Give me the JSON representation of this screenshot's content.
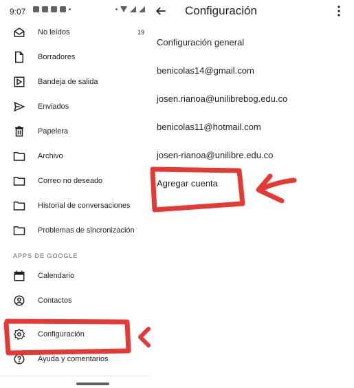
{
  "status_bar": {
    "time": "9:07"
  },
  "drawer": {
    "items": [
      {
        "label": "No leídos",
        "count": "19",
        "icon": "inbox-icon"
      },
      {
        "label": "Borradores",
        "icon": "draft-icon"
      },
      {
        "label": "Bandeja de salida",
        "icon": "outbox-icon"
      },
      {
        "label": "Enviados",
        "icon": "send-icon"
      },
      {
        "label": "Papelera",
        "icon": "trash-icon"
      },
      {
        "label": "Archivo",
        "icon": "folder-icon"
      },
      {
        "label": "Correo no deseado",
        "icon": "folder-icon"
      },
      {
        "label": "Historial de conversaciones",
        "icon": "folder-icon"
      },
      {
        "label": "Problemas de sincronización",
        "icon": "folder-icon"
      }
    ],
    "apps_section_title": "APPS DE GOOGLE",
    "apps": [
      {
        "label": "Calendario",
        "icon": "calendar-icon"
      },
      {
        "label": "Contactos",
        "icon": "contacts-icon"
      },
      {
        "label": "Configuración",
        "icon": "gear-icon"
      },
      {
        "label": "Ayuda y comentarios",
        "icon": "help-icon"
      }
    ]
  },
  "settings": {
    "title": "Configuración",
    "rows": [
      "Configuración general",
      "benicolas14@gmail.com",
      "josen.rianoa@unilibrebog.edu.co",
      "benicolas11@hotmail.com",
      "josen-rianoa@unilibre.edu.co",
      "Agregar cuenta"
    ]
  },
  "colors": {
    "annotation": "#e53935",
    "icon": "#5f6368",
    "text": "#202124"
  }
}
